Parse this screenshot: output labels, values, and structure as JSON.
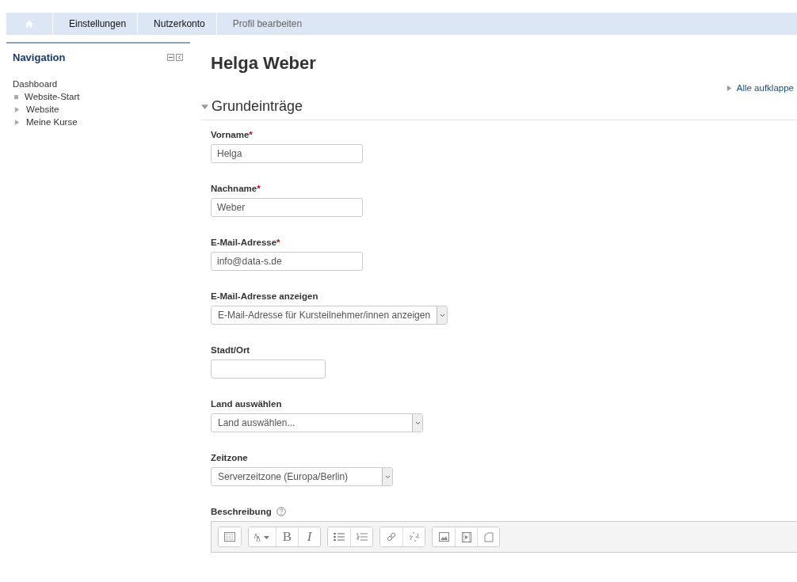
{
  "breadcrumb": [
    {
      "kind": "home"
    },
    {
      "label": "Einstellungen",
      "kind": "link"
    },
    {
      "label": "Nutzerkonto",
      "kind": "link"
    },
    {
      "label": "Profil bearbeiten",
      "kind": "current"
    }
  ],
  "navigation": {
    "title": "Navigation",
    "items": [
      {
        "label": "Dashboard",
        "kind": "plain"
      },
      {
        "label": "Website-Start",
        "kind": "leaf"
      },
      {
        "label": "Website",
        "kind": "branch",
        "expanded": false
      },
      {
        "label": "Meine Kurse",
        "kind": "branch",
        "expanded": false
      }
    ]
  },
  "page_title": "Helga Weber",
  "expand_all": "Alle aufklappe",
  "section": {
    "title": "Grundeinträge",
    "expanded": true
  },
  "fields": [
    {
      "label": "Vorname",
      "required_mark": "*",
      "kind": "text",
      "value": "Helga"
    },
    {
      "label": "Nachname",
      "required_mark": "*",
      "kind": "text",
      "value": "Weber"
    },
    {
      "label": "E-Mail-Adresse",
      "required_mark": "*",
      "kind": "text",
      "value": "info@data-s.de"
    },
    {
      "label": "E-Mail-Adresse anzeigen",
      "kind": "select",
      "value": "E-Mail-Adresse für Kursteilnehmer/innen anzeigen"
    },
    {
      "label": "Stadt/Ort",
      "kind": "text"
    },
    {
      "label": "Land auswählen",
      "kind": "select",
      "value": "Land auswählen..."
    },
    {
      "label": "Zeitzone",
      "kind": "select",
      "value": "Serverzeitzone (Europa/Berlin)"
    }
  ],
  "description": {
    "label": "Beschreibung",
    "toolbar": [
      [
        {
          "kind": "html"
        }
      ],
      [
        {
          "kind": "font"
        },
        {
          "kind": "bold",
          "label": "B"
        },
        {
          "kind": "italic",
          "label": "I"
        }
      ],
      [
        {
          "kind": "bullets"
        },
        {
          "kind": "numbers"
        }
      ],
      [
        {
          "kind": "link"
        },
        {
          "kind": "unlink"
        }
      ],
      [
        {
          "kind": "image"
        },
        {
          "kind": "media"
        },
        {
          "kind": "files"
        }
      ]
    ]
  }
}
